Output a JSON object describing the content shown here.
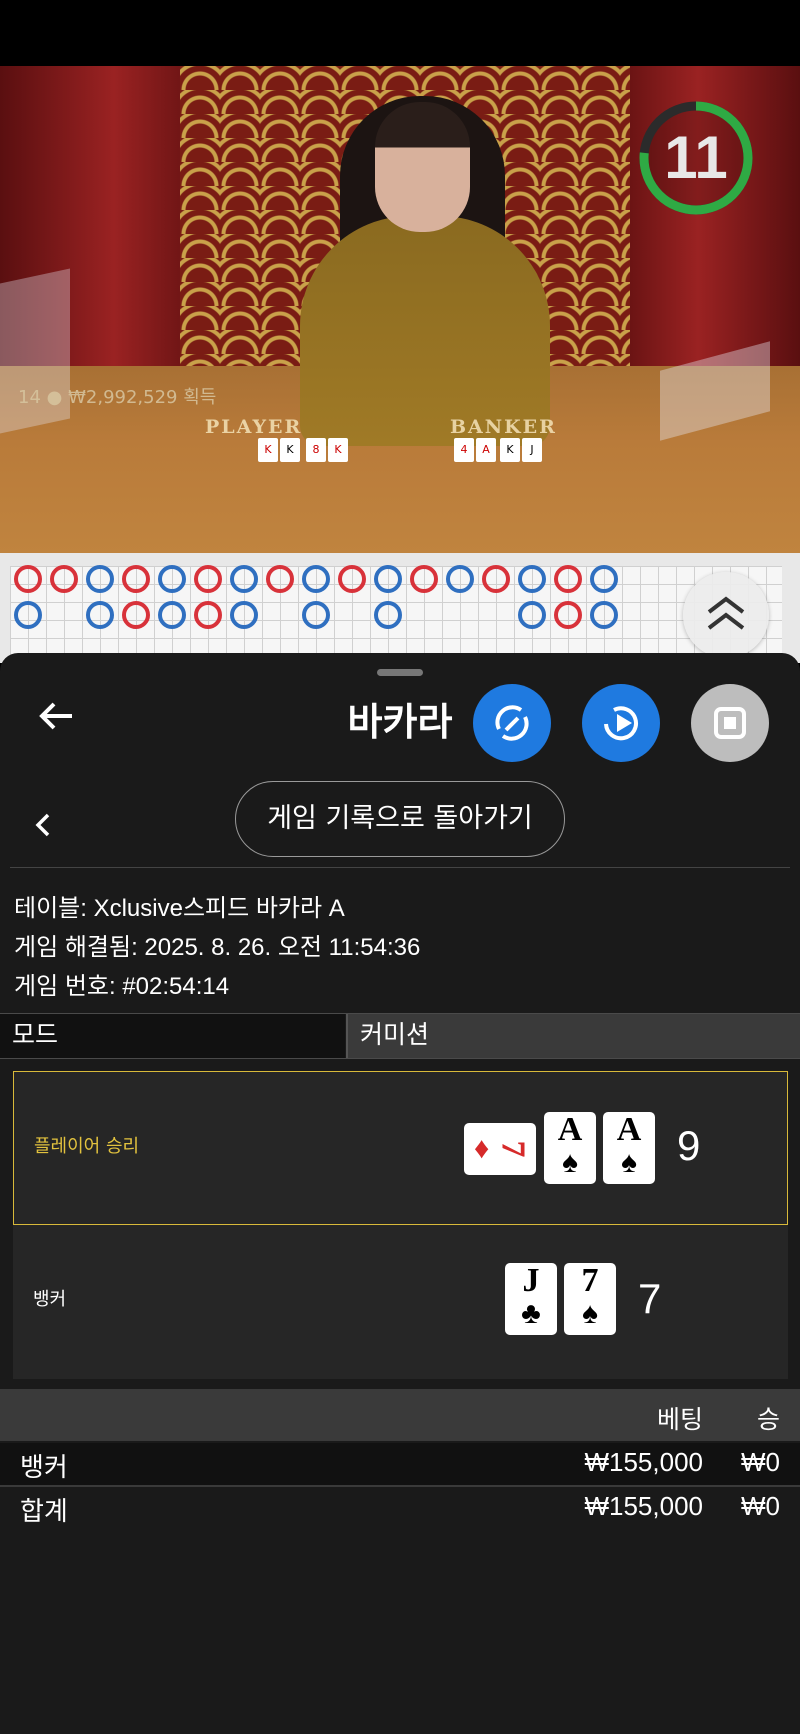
{
  "video": {
    "countdown": "11",
    "winners_count": "14",
    "winners_amount": "₩2,992,529",
    "winners_suffix": "획득",
    "player_label": "PLAYER",
    "banker_label": "BANKER",
    "timer_color": "#2faa44"
  },
  "header": {
    "title": "바카라",
    "back_icon": "arrow-left-icon",
    "btn1_icon": "refresh-swap-icon",
    "btn2_icon": "replay-video-icon",
    "btn3_icon": "stop-icon"
  },
  "nav": {
    "back_to_history": "게임 기록으로 돌아가기"
  },
  "game_info": {
    "table": "테이블: Xclusive스피드 바카라 A",
    "resolved": "게임 해결됨: 2025. 8. 26. 오전 11:54:36",
    "number": "게임 번호: #02:54:14"
  },
  "tabs": {
    "mode": "모드",
    "commission": "커미션"
  },
  "results": {
    "player": {
      "label": "플레이어 승리",
      "score": "9",
      "cards": [
        {
          "rank": "7",
          "suit": "♦",
          "color": "#d62a2a"
        },
        {
          "rank": "A",
          "suit": "♠",
          "color": "#000000"
        },
        {
          "rank": "A",
          "suit": "♠",
          "color": "#000000"
        }
      ]
    },
    "banker": {
      "label": "뱅커",
      "score": "7",
      "cards": [
        {
          "rank": "J",
          "suit": "♣",
          "color": "#000000"
        },
        {
          "rank": "7",
          "suit": "♠",
          "color": "#000000"
        }
      ]
    },
    "winner_color": "#d8b93a"
  },
  "bets": {
    "header_bet": "베팅",
    "header_win": "승",
    "rows": [
      {
        "name": "뱅커",
        "bet": "₩155,000",
        "win": "₩0"
      },
      {
        "name": "합계",
        "bet": "₩155,000",
        "win": "₩0"
      }
    ]
  }
}
